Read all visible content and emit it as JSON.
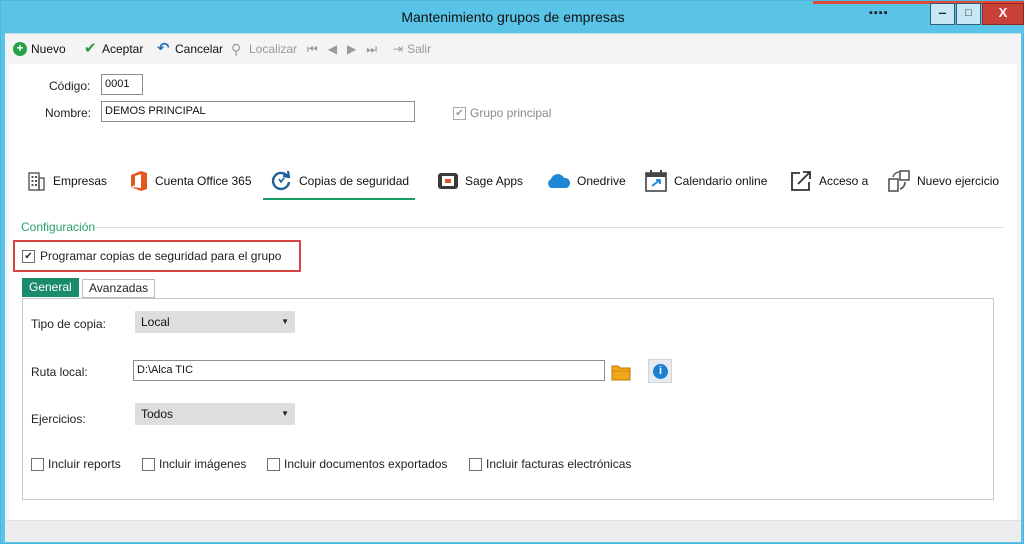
{
  "window": {
    "title": "Mantenimiento grupos de empresas",
    "title_extra": "▪▪▪▪",
    "minimize": "‒",
    "maximize": "□",
    "close": "X"
  },
  "toolbar": {
    "nuevo": "Nuevo",
    "aceptar": "Aceptar",
    "cancelar": "Cancelar",
    "localizar": "Localizar",
    "salir": "Salir"
  },
  "form": {
    "codigo_label": "Código:",
    "codigo_value": "0001",
    "nombre_label": "Nombre:",
    "nombre_value": "DEMOS PRINCIPAL",
    "grupo_principal_label": "Grupo principal",
    "grupo_principal_checked": true
  },
  "tabs": [
    {
      "label": "Empresas",
      "icon": "building-icon"
    },
    {
      "label": "Cuenta Office 365",
      "icon": "office-icon"
    },
    {
      "label": "Copias de seguridad",
      "icon": "sync-icon",
      "active": true
    },
    {
      "label": "Sage Apps",
      "icon": "sage-apps-icon"
    },
    {
      "label": "Onedrive",
      "icon": "cloud-icon"
    },
    {
      "label": "Calendario online",
      "icon": "calendar-icon"
    },
    {
      "label": "Acceso a",
      "icon": "external-link-icon"
    },
    {
      "label": "Nuevo ejercicio",
      "icon": "new-exercise-icon"
    }
  ],
  "config": {
    "section_title": "Configuración",
    "programar_label": "Programar copias de seguridad para el grupo",
    "programar_checked": true,
    "subtabs": [
      "General",
      "Avanzadas"
    ],
    "tipo_copia_label": "Tipo de copia:",
    "tipo_copia_value": "Local",
    "ruta_local_label": "Ruta local:",
    "ruta_local_value": "D:\\Alca TIC",
    "ejercicios_label": "Ejercicios:",
    "ejercicios_value": "Todos",
    "checkboxes": [
      {
        "label": "Incluir reports",
        "checked": false
      },
      {
        "label": "Incluir imágenes",
        "checked": false
      },
      {
        "label": "Incluir documentos exportados",
        "checked": false
      },
      {
        "label": "Incluir facturas electrónicas",
        "checked": false
      }
    ]
  },
  "colors": {
    "accent_green": "#1a9e68",
    "title_bar": "#5ac4e8",
    "highlight_red": "#d6453d"
  }
}
